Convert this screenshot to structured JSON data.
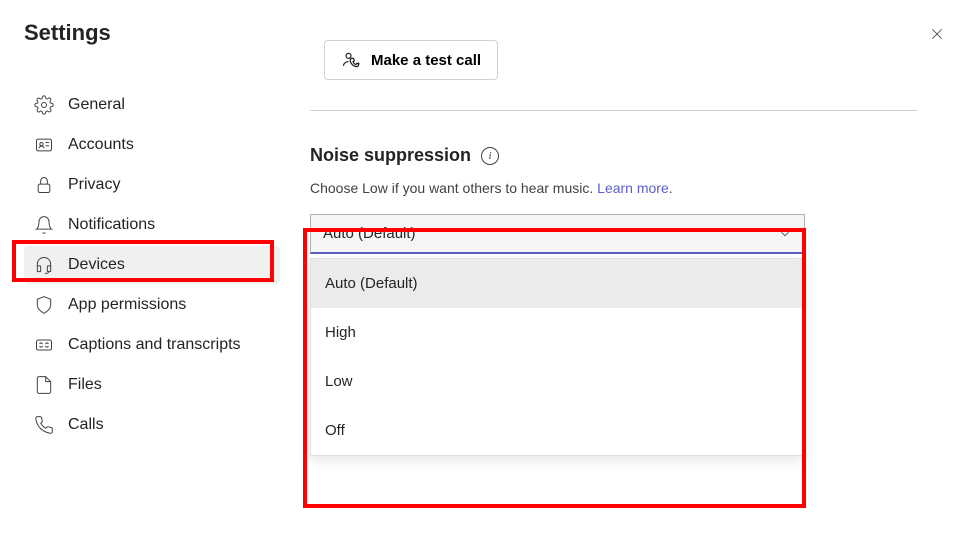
{
  "title": "Settings",
  "sidebar": {
    "items": [
      {
        "label": "General"
      },
      {
        "label": "Accounts"
      },
      {
        "label": "Privacy"
      },
      {
        "label": "Notifications"
      },
      {
        "label": "Devices"
      },
      {
        "label": "App permissions"
      },
      {
        "label": "Captions and transcripts"
      },
      {
        "label": "Files"
      },
      {
        "label": "Calls"
      }
    ]
  },
  "main": {
    "test_call_label": "Make a test call",
    "section_title": "Noise suppression",
    "section_desc": "Choose Low if you want others to hear music.",
    "learn_more": "Learn more",
    "dropdown_value": "Auto (Default)",
    "options": [
      {
        "label": "Auto (Default)"
      },
      {
        "label": "High"
      },
      {
        "label": "Low"
      },
      {
        "label": "Off"
      }
    ]
  }
}
